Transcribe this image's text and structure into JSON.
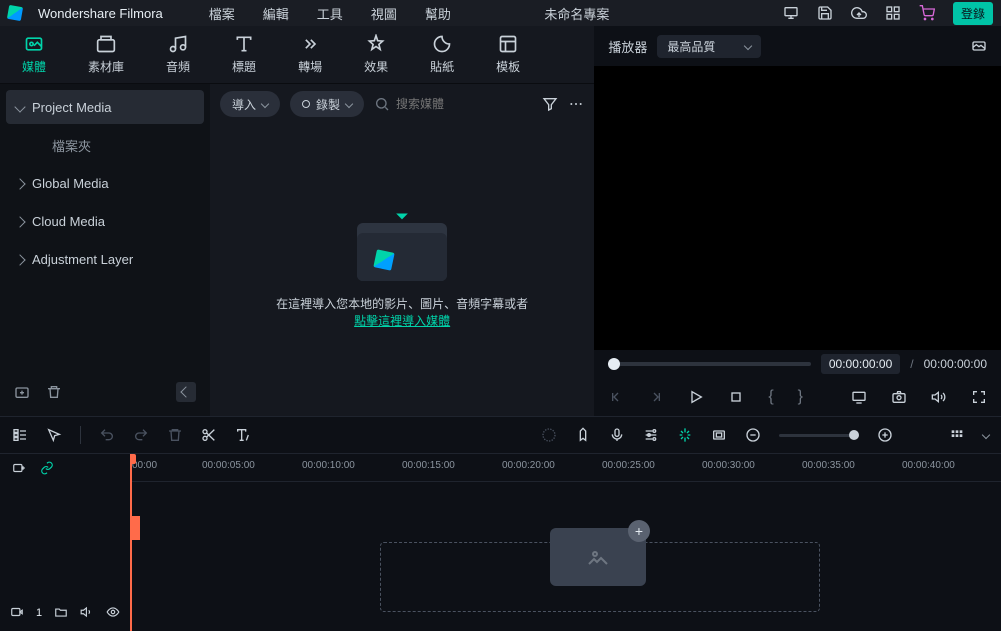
{
  "app": {
    "name": "Wondershare Filmora",
    "project_title": "未命名專案",
    "login": "登錄"
  },
  "menu": [
    "檔案",
    "編輯",
    "工具",
    "視圖",
    "幫助"
  ],
  "tabs": [
    {
      "label": "媒體",
      "icon": "media"
    },
    {
      "label": "素材庫",
      "icon": "stock"
    },
    {
      "label": "音頻",
      "icon": "audio"
    },
    {
      "label": "標題",
      "icon": "title"
    },
    {
      "label": "轉場",
      "icon": "transition"
    },
    {
      "label": "效果",
      "icon": "effect"
    },
    {
      "label": "貼紙",
      "icon": "sticker"
    },
    {
      "label": "模板",
      "icon": "template"
    }
  ],
  "sidebar": {
    "items": [
      {
        "label": "Project Media",
        "expanded": true,
        "selected": true
      },
      {
        "label": "檔案夾",
        "sub": true
      },
      {
        "label": "Global Media"
      },
      {
        "label": "Cloud Media"
      },
      {
        "label": "Adjustment Layer"
      }
    ]
  },
  "media_toolbar": {
    "import": "導入",
    "record": "錄製",
    "search_placeholder": "搜索媒體"
  },
  "empty": {
    "line1": "在這裡導入您本地的影片、圖片、音頻字幕或者",
    "link": "點擊這裡導入媒體"
  },
  "player": {
    "label": "播放器",
    "quality": "最高品質",
    "current": "00:00:00:00",
    "duration": "00:00:00:00"
  },
  "ruler": [
    "00:00",
    "00:00:05:00",
    "00:00:10:00",
    "00:00:15:00",
    "00:00:20:00",
    "00:00:25:00",
    "00:00:30:00",
    "00:00:35:00",
    "00:00:40:00"
  ],
  "track": {
    "video_num": "1"
  },
  "colors": {
    "accent": "#00d4aa",
    "playhead": "#ff6b4a"
  }
}
